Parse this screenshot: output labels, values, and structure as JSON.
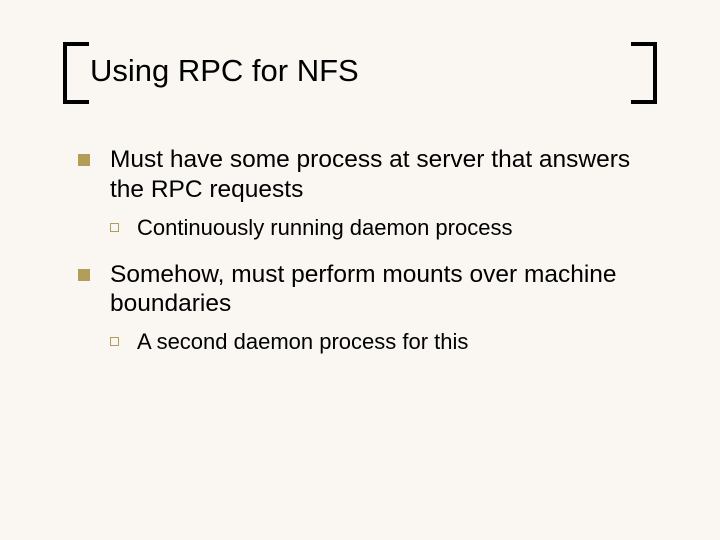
{
  "title": "Using RPC for NFS",
  "items": [
    {
      "text": "Must have some process at server that answers the RPC requests",
      "sub": "Continuously running daemon process"
    },
    {
      "text": "Somehow, must perform mounts over machine boundaries",
      "sub": "A second daemon process for this"
    }
  ]
}
